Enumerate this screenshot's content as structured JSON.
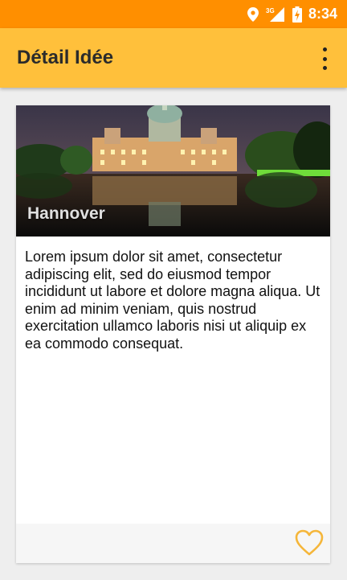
{
  "status_bar": {
    "time": "8:34",
    "network_label": "3G",
    "icons": [
      "location-icon",
      "cellular-signal-icon",
      "battery-charging-icon"
    ]
  },
  "toolbar": {
    "title": "Détail Idée",
    "menu_icon": "overflow-menu-icon"
  },
  "card": {
    "image_caption": "Hannover",
    "body": "Lorem ipsum dolor sit amet, consectetur adipiscing elit, sed do eiusmod tempor incididunt ut labore et dolore magna aliqua. Ut enim ad minim veniam, quis nostrud exercitation ullamco laboris nisi ut aliquip ex ea commodo consequat.",
    "favorite_icon": "heart-outline-icon"
  },
  "colors": {
    "status_bar": "#ff8f00",
    "toolbar": "#ffc03b",
    "accent_heart": "#f5b63a",
    "background": "#eeeeee"
  }
}
